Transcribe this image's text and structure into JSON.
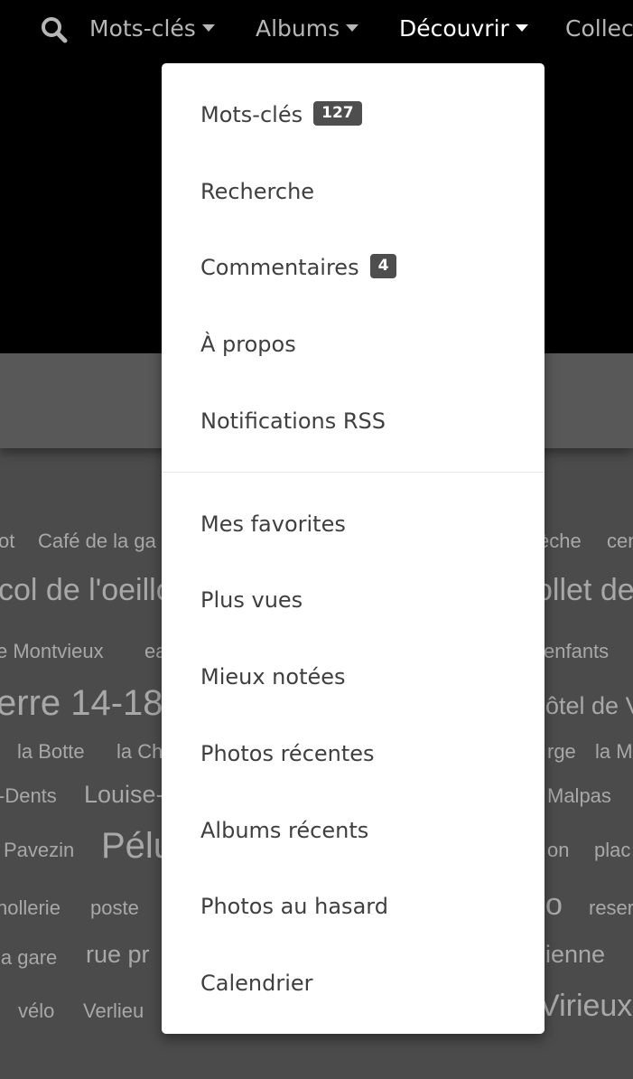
{
  "nav": {
    "items": [
      {
        "label": "Mots-clés"
      },
      {
        "label": "Albums"
      },
      {
        "label": "Découvrir"
      },
      {
        "label": "Collect"
      }
    ]
  },
  "dropdown": {
    "group1": [
      {
        "label": "Mots-clés",
        "badge": "127"
      },
      {
        "label": "Recherche"
      },
      {
        "label": "Commentaires",
        "badge": "4"
      },
      {
        "label": "À propos"
      },
      {
        "label": "Notifications RSS"
      }
    ],
    "group2": [
      {
        "label": "Mes favorites"
      },
      {
        "label": "Plus vues"
      },
      {
        "label": "Mieux notées"
      },
      {
        "label": "Photos récentes"
      },
      {
        "label": "Albums récents"
      },
      {
        "label": "Photos au hasard"
      },
      {
        "label": "Calendrier"
      }
    ]
  },
  "tags": [
    "ot",
    "Café de la ga",
    "èche",
    "cen",
    "col de l'oeillo",
    "ollet de",
    "e Montvieux",
    "ea",
    "enfants",
    "erre 14-18",
    "ôtel de V",
    "la Botte",
    "la Ch",
    "rge",
    "la M",
    "-Dents",
    "Louise-",
    "Malpas",
    "Pavezin",
    "Pélu",
    "on",
    "plac",
    "hollerie",
    "poste",
    "o",
    "reser",
    "la gare",
    "rue pr",
    "ienne",
    "vélo",
    "Verlieu",
    "Virieux"
  ],
  "colors": {
    "navbar_bg": "#000000",
    "nav_text": "#b6b6b6",
    "nav_active": "#ffffff",
    "page_bg": "#4b4b4b",
    "badge_bg": "#4e4e4e",
    "menu_text": "#3f3f3f"
  }
}
